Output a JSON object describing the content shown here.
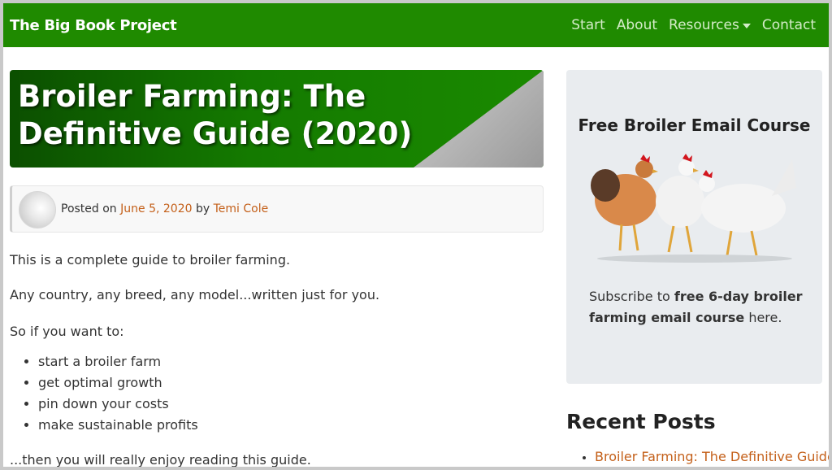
{
  "navbar": {
    "brand": "The Big Book Project",
    "links": [
      "Start",
      "About",
      "Resources",
      "Contact"
    ],
    "bg_color": "#1f8a00"
  },
  "article": {
    "title": "Broiler Farming: The Definitive Guide (2020)",
    "meta": {
      "posted_on": "Posted on",
      "date": "June 5, 2020",
      "by": "by",
      "author": "Temi Cole"
    },
    "paragraphs": [
      "This is a complete guide to broiler farming.",
      "Any country, any breed, any model...written just for you.",
      "So if you want to:"
    ],
    "bullets": [
      "start a broiler farm",
      "get optimal growth",
      "pin down your costs",
      "make sustainable profits"
    ],
    "closing": "...then you will really enjoy reading this guide."
  },
  "sidebar": {
    "widget_title": "Free Broiler Email Course",
    "subscribe_prefix": "Subscribe to",
    "subscribe_bold": "free 6-day broiler farming email course",
    "subscribe_suffix": "here.",
    "recent_title": "Recent Posts",
    "recent_posts": [
      "Broiler Farming: The Definitive Guide"
    ]
  },
  "colors": {
    "link": "#c4601a",
    "accent": "#1f8a00"
  }
}
